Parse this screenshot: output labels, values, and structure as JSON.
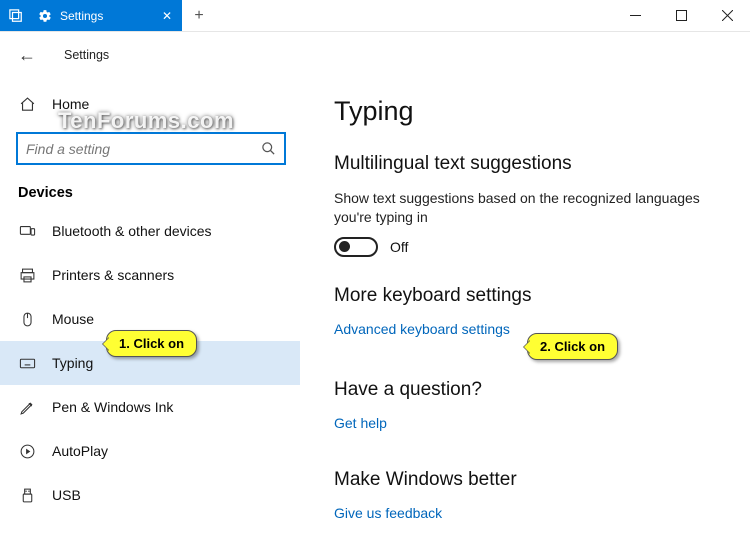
{
  "titlebar": {
    "tab_label": "Settings",
    "minimize": "—",
    "maximize": "▢",
    "close": "✕",
    "tab_close": "✕",
    "new_tab": "+"
  },
  "header": {
    "back_glyph": "←",
    "app_title": "Settings"
  },
  "search": {
    "placeholder": "Find a setting",
    "icon_glyph": "🔍"
  },
  "sidebar": {
    "home": "Home",
    "category": "Devices",
    "items": [
      {
        "label": "Bluetooth & other devices"
      },
      {
        "label": "Printers & scanners"
      },
      {
        "label": "Mouse"
      },
      {
        "label": "Typing"
      },
      {
        "label": "Pen & Windows Ink"
      },
      {
        "label": "AutoPlay"
      },
      {
        "label": "USB"
      }
    ]
  },
  "content": {
    "page_title": "Typing",
    "section1": {
      "title": "Multilingual text suggestions",
      "desc": "Show text suggestions based on the recognized languages you're typing in",
      "toggle_state": "Off"
    },
    "section2": {
      "title": "More keyboard settings",
      "link": "Advanced keyboard settings"
    },
    "section3": {
      "title": "Have a question?",
      "link": "Get help"
    },
    "section4": {
      "title": "Make Windows better",
      "link": "Give us feedback"
    }
  },
  "callouts": {
    "c1": "1. Click on",
    "c2": "2. Click on"
  },
  "watermark": "TenForums.com"
}
